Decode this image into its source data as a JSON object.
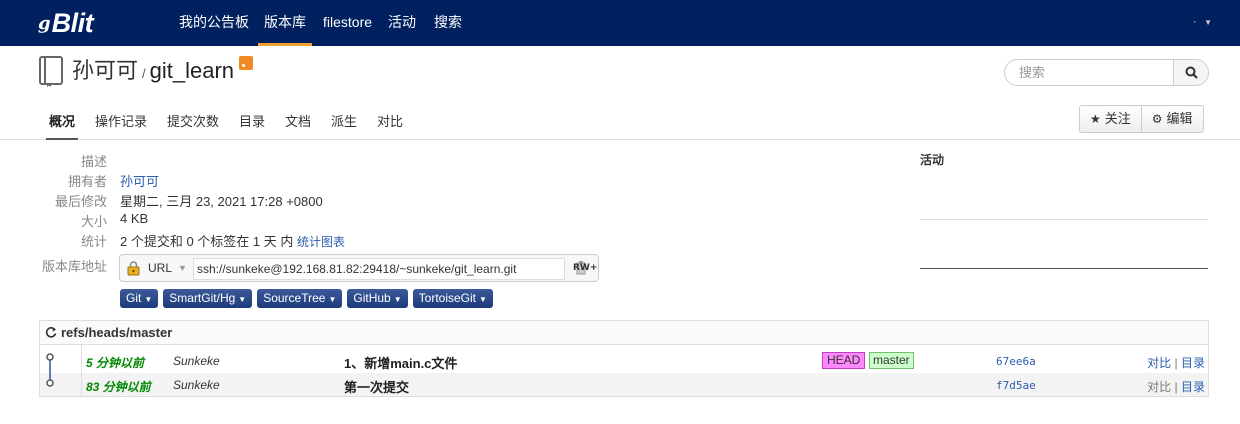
{
  "app": {
    "logo_mark": "g",
    "logo_text": "Blit"
  },
  "nav": {
    "items": [
      "我的公告板",
      "版本库",
      "filestore",
      "活动",
      "搜索"
    ],
    "active_index": 1,
    "user_menu": "·"
  },
  "repo": {
    "owner": "孙可可",
    "separator": "/",
    "name": "git_learn",
    "icon": "book-icon",
    "rss_icon": "rss-icon"
  },
  "search": {
    "placeholder": "搜索",
    "button_icon": "search-icon"
  },
  "tabs": [
    "概况",
    "操作记录",
    "提交次数",
    "目录",
    "文档",
    "派生",
    "对比"
  ],
  "actions": {
    "watch": "关注",
    "edit": "编辑"
  },
  "summary": {
    "description_label": "描述",
    "owner_label": "拥有者",
    "owner_value": "孙可可",
    "modified_label": "最后修改",
    "modified_value": "星期二, 三月 23, 2021 17:28 +0800",
    "size_label": "大小",
    "size_value": "4 KB",
    "stats_label": "统计",
    "stats_value": "2 个提交和 0 个标签在 1 天 内",
    "stats_link": "统计图表",
    "url_label": "版本库地址"
  },
  "clone": {
    "protocol": "URL",
    "url": "ssh://sunkeke@192.168.81.82:29418/~sunkeke/git_learn.git",
    "permission": "RW+"
  },
  "clients": [
    "Git",
    "SmartGit/Hg",
    "SourceTree",
    "GitHub",
    "TortoiseGit"
  ],
  "activity": {
    "label": "活动"
  },
  "log": {
    "ref": "refs/heads/master",
    "rows": [
      {
        "time": "5 分钟以前",
        "author": "Sunkeke",
        "message": "1、新增main.c文件",
        "refs": [
          "HEAD",
          "master"
        ],
        "hash": "67ee6a",
        "links": [
          "对比",
          "目录"
        ]
      },
      {
        "time": "83 分钟以前",
        "author": "Sunkeke",
        "message": "第一次提交",
        "refs": [],
        "hash": "f7d5ae",
        "links": [
          "对比",
          "目录"
        ]
      }
    ]
  },
  "colors": {
    "navbar": "#002060",
    "nav_active": "#f0a030",
    "link": "#2a5db0",
    "time": "#008800",
    "head_ref": "#ff88ff",
    "branch_ref": "#ccffcc"
  }
}
